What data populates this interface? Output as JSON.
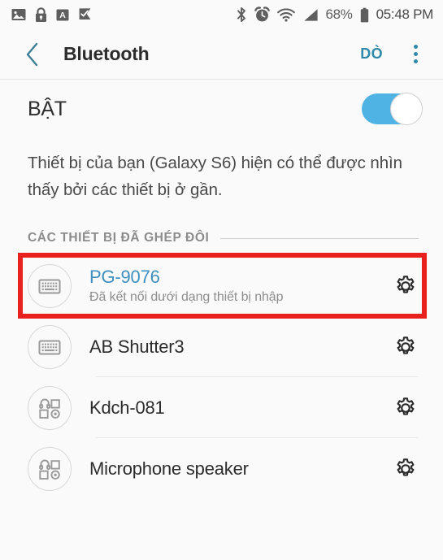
{
  "status_bar": {
    "left_icons": [
      {
        "name": "photo-icon",
        "label": "photo"
      },
      {
        "name": "lock-icon",
        "label": "lock"
      },
      {
        "name": "font-a-icon",
        "label": "A"
      },
      {
        "name": "checkmark-flag-icon",
        "label": "flag check"
      }
    ],
    "right_icons": [
      {
        "name": "bluetooth-icon",
        "label": "bluetooth"
      },
      {
        "name": "alarm-icon",
        "label": "alarm"
      },
      {
        "name": "wifi-icon",
        "label": "wifi"
      },
      {
        "name": "signal-icon",
        "label": "signal"
      }
    ],
    "battery_percent": "68%",
    "clock": "05:48 PM"
  },
  "app_bar": {
    "back_icon": "chevron-left-icon",
    "title": "Bluetooth",
    "scan_label": "DÒ",
    "overflow_icon": "more-vertical-icon"
  },
  "toggle": {
    "label": "BẬT",
    "state": "on"
  },
  "description": "Thiết bị của bạn (Galaxy S6) hiện có thể được nhìn thấy bởi các thiết bị ở gần.",
  "paired_section": {
    "title": "CÁC THIẾT BỊ ĐÃ GHÉP ĐÔI",
    "devices": [
      {
        "name": "PG-9076",
        "subtitle": "Đã kết nối dưới dạng thiết bị nhập",
        "icon": "keyboard-icon",
        "connected": true,
        "settings_icon": "gear-icon",
        "highlighted": true
      },
      {
        "name": "AB Shutter3",
        "subtitle": "",
        "icon": "keyboard-icon",
        "connected": false,
        "settings_icon": "gear-icon",
        "highlighted": false
      },
      {
        "name": "Kdch-081",
        "subtitle": "",
        "icon": "other-device-icon",
        "connected": false,
        "settings_icon": "gear-icon",
        "highlighted": false
      },
      {
        "name": "Microphone speaker",
        "subtitle": "",
        "icon": "other-device-icon",
        "connected": false,
        "settings_icon": "gear-icon",
        "highlighted": false
      }
    ]
  },
  "colors": {
    "accent_teal": "#2f89a8",
    "connected_blue": "#3f8fbf",
    "toggle_on": "#4fb4e4",
    "annotation_red": "#e8201e",
    "background": "#fafafa"
  }
}
